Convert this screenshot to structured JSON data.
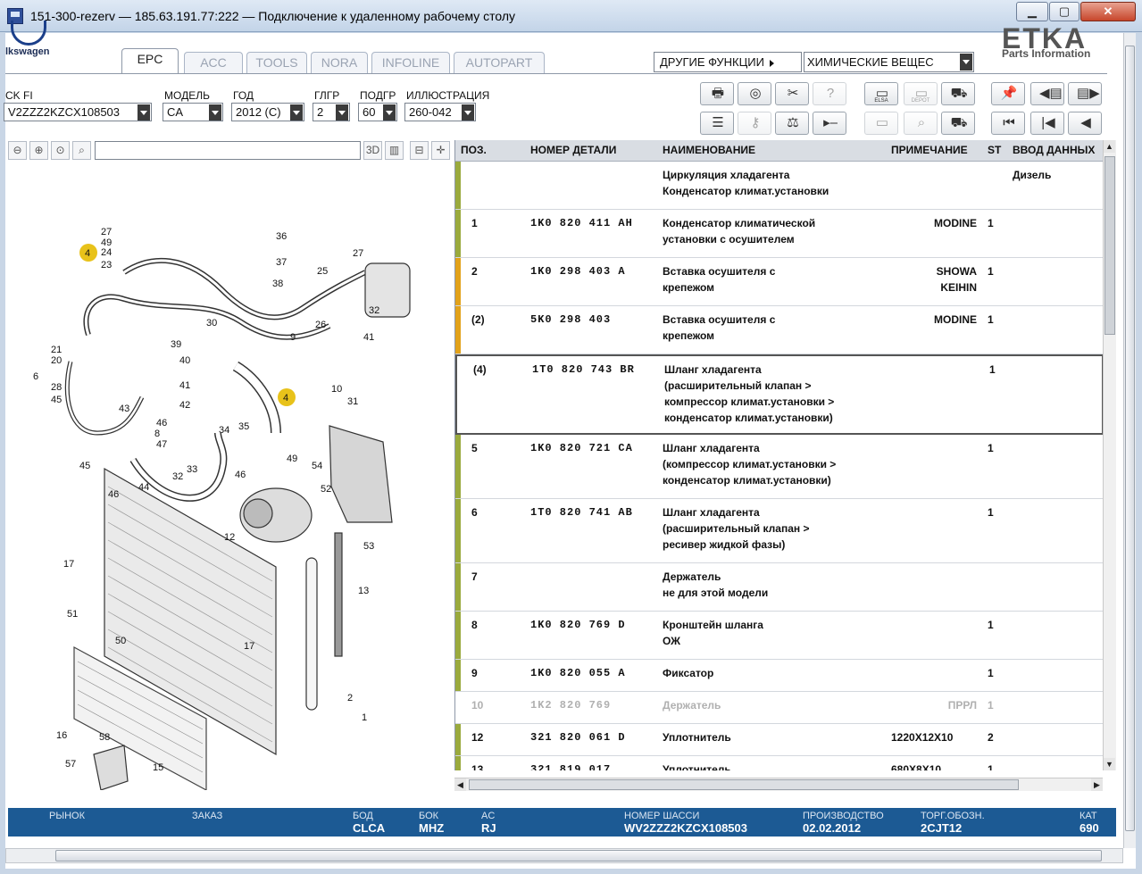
{
  "window": {
    "title": "151-300-rezerv — 185.63.191.77:222 — Подключение к удаленному рабочему столу",
    "minimize": "▁",
    "maximize": "▢",
    "close": "✕"
  },
  "branding": {
    "vw_text": "lkswagen",
    "etka_big": "ETKA",
    "etka_sub": "Parts Information"
  },
  "tabs": [
    {
      "label": "EPC",
      "active": true
    },
    {
      "label": "ACC",
      "active": false
    },
    {
      "label": "TOOLS",
      "active": false
    },
    {
      "label": "NORA",
      "active": false
    },
    {
      "label": "INFOLINE",
      "active": false
    },
    {
      "label": "AUTOPART",
      "active": false
    }
  ],
  "functions": {
    "button_label": "ДРУГИЕ ФУНКЦИИ",
    "chem_value": "ХИМИЧЕСКИЕ ВЕЩЕС"
  },
  "selectors": {
    "vin": {
      "label": "CK FI",
      "value": "V2ZZZ2KZCX108503"
    },
    "model": {
      "label": "МОДЕЛЬ",
      "value": "CA"
    },
    "year": {
      "label": "ГОД",
      "value": "2012 (C)"
    },
    "mg": {
      "label": "ГЛГР",
      "value": "2"
    },
    "sg": {
      "label": "ПОДГР",
      "value": "60"
    },
    "ill": {
      "label": "ИЛЛЮСТРАЦИЯ",
      "value": "260-042"
    }
  },
  "toolbar": {
    "elsa": "ELSA",
    "depot": "DEPOT"
  },
  "illustration_tools": {
    "three_d": "3D"
  },
  "table": {
    "headers": {
      "pos": "ПОЗ.",
      "num": "НОМЕР ДЕТАЛИ",
      "name": "НАИМЕНОВАНИЕ",
      "note": "ПРИМЕЧАНИЕ",
      "st": "ST",
      "input": "ВВОД ДАННЫХ"
    },
    "rows": [
      {
        "pos": "",
        "num": "",
        "name": "Циркуляция хладагента\nКонденсатор климат.установки",
        "note": "",
        "st": "",
        "input": "Дизель"
      },
      {
        "pos": "1",
        "num": "1K0 820 411 AH",
        "name": "Конденсатор климатической\nустановки с осушителем",
        "note": "MODINE",
        "st": "1",
        "input": ""
      },
      {
        "pos": "2",
        "num": "1K0 298 403 A",
        "name": "Вставка осушителя с\nкрепежом",
        "note": "SHOWA\nKEIHIN",
        "st": "1",
        "input": ""
      },
      {
        "pos": "(2)",
        "num": "5K0 298 403",
        "name": "Вставка осушителя с\nкрепежом",
        "note": "MODINE",
        "st": "1",
        "input": ""
      },
      {
        "pos": "(4)",
        "num": "1T0 820 743 BR",
        "name": "Шланг хладагента\n(расширительный клапан >\nкомпрессор климат.установки >\nконденсатор климат.установки)",
        "note": "",
        "st": "1",
        "input": ""
      },
      {
        "pos": "5",
        "num": "1K0 820 721 CA",
        "name": "Шланг хладагента\n(компрессор климат.установки >\nконденсатор климат.установки)",
        "note": "",
        "st": "1",
        "input": ""
      },
      {
        "pos": "6",
        "num": "1T0 820 741 AB",
        "name": "Шланг хладагента\n(расширительный клапан >\nресивер жидкой фазы)",
        "note": "",
        "st": "1",
        "input": ""
      },
      {
        "pos": "7",
        "num": "",
        "name": "Держатель\nне для этой модели",
        "note": "",
        "st": "",
        "input": ""
      },
      {
        "pos": "8",
        "num": "1K0 820 769 D",
        "name": "Кронштейн шланга\nОЖ",
        "note": "",
        "st": "1",
        "input": ""
      },
      {
        "pos": "9",
        "num": "1K0 820 055 A",
        "name": "Фиксатор",
        "note": "",
        "st": "1",
        "input": ""
      },
      {
        "pos": "10",
        "num": "1K2 820 769",
        "name": "Держатель",
        "note": "ПРРЛ",
        "st": "1",
        "input": ""
      },
      {
        "pos": "12",
        "num": "321 820 061 D",
        "name": "Уплотнитель",
        "note": "1220X12X10",
        "st": "2",
        "input": ""
      },
      {
        "pos": "13",
        "num": "321 819 017",
        "name": "Уплотнитель",
        "note": "680X8X10",
        "st": "1",
        "input": ""
      }
    ]
  },
  "statusbar": {
    "market_label": "РЫНОК",
    "order_label": "ЗАКАЗ",
    "bod_label": "БОД",
    "bod_value": "CLCA",
    "bok_label": "БОК",
    "bok_value": "MHZ",
    "ac_label": "AC",
    "ac_value": "RJ",
    "chassis_label": "НОМЕР ШАССИ",
    "chassis_value": "WV2ZZZ2KZCX108503",
    "prod_label": "ПРОИЗВОДСТВО",
    "prod_value": "02.02.2012",
    "trade_label": "ТОРГ.ОБОЗН.",
    "trade_value": "2CJT12",
    "cat_label": "КАТ",
    "cat_value": "690"
  },
  "illustration_callouts": [
    "27",
    "49",
    "24",
    "23",
    "4",
    "36",
    "37",
    "38",
    "25",
    "27",
    "21",
    "20",
    "6",
    "28",
    "45",
    "39",
    "40",
    "41",
    "42",
    "30",
    "9",
    "26",
    "32",
    "41",
    "10",
    "31",
    "4",
    "43",
    "46",
    "47",
    "8",
    "34",
    "35",
    "49",
    "54",
    "45",
    "46",
    "44",
    "32",
    "33",
    "46",
    "52",
    "17",
    "12",
    "53",
    "51",
    "50",
    "13",
    "17",
    "2",
    "1",
    "16",
    "58",
    "57",
    "15"
  ]
}
